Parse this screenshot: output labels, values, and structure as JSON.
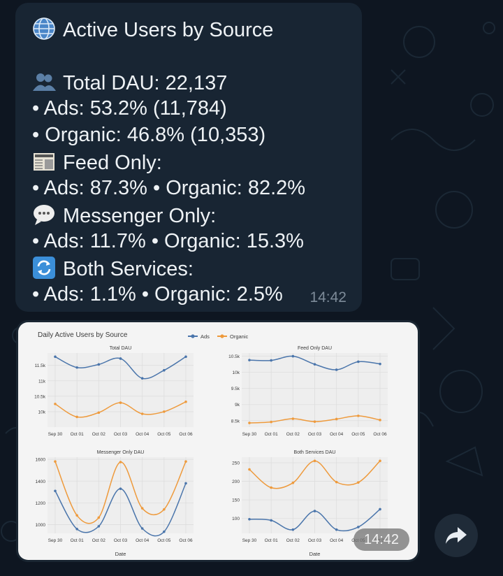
{
  "message": {
    "title_line": "Active Users by Source",
    "total_line": "Total DAU: 22,137",
    "ads_total": "• Ads: 53.2% (11,784)",
    "organic_total": "• Organic: 46.8% (10,353)",
    "feed_heading": "Feed Only:",
    "feed_line": "• Ads: 87.3% • Organic: 82.2%",
    "messenger_heading": "Messenger Only:",
    "messenger_line": "• Ads: 11.7% • Organic: 15.3%",
    "both_heading": "Both Services:",
    "both_line": "• Ads: 1.1% • Organic: 2.5%",
    "time": "14:42",
    "icons": [
      "globe-icon",
      "users-icon",
      "newspaper-icon",
      "speech-bubble-icon",
      "refresh-arrows-icon"
    ]
  },
  "photo": {
    "time": "14:42"
  },
  "share_icon": "share-arrow-icon",
  "colors": {
    "ads": "#4a75ab",
    "organic": "#ee9a3c",
    "bubble": "#182533",
    "background": "#0e1621"
  },
  "chart_data": {
    "title": "Daily Active Users by Source",
    "legend": [
      "Ads",
      "Organic"
    ],
    "legend_position": "top-center",
    "x": [
      "Sep 30",
      "Oct 01",
      "Oct 02",
      "Oct 03",
      "Oct 04",
      "Oct 05",
      "Oct 06"
    ],
    "xlabel": "Date",
    "panels": [
      {
        "title": "Total DAU",
        "type": "line",
        "ylim": [
          9500,
          11900
        ],
        "yticks": [
          10000,
          10500,
          11000,
          11500
        ],
        "ytick_labels": [
          "10k",
          "10.5k",
          "11k",
          "11.5k"
        ],
        "series": [
          {
            "name": "Ads",
            "values": [
              11780,
              11430,
              11530,
              11720,
              11080,
              11340,
              11780
            ]
          },
          {
            "name": "Organic",
            "values": [
              10250,
              9830,
              9970,
              10290,
              9930,
              10000,
              10320
            ]
          }
        ]
      },
      {
        "title": "Feed Only DAU",
        "type": "line",
        "ylim": [
          8300,
          10600
        ],
        "yticks": [
          8500,
          9000,
          9500,
          10000,
          10500
        ],
        "ytick_labels": [
          "8.5k",
          "9k",
          "9.5k",
          "10k",
          "10.5k"
        ],
        "series": [
          {
            "name": "Ads",
            "values": [
              10380,
              10370,
              10500,
              10250,
              10080,
              10330,
              10260
            ]
          },
          {
            "name": "Organic",
            "values": [
              8430,
              8460,
              8560,
              8470,
              8550,
              8650,
              8520
            ]
          }
        ]
      },
      {
        "title": "Messenger Only DAU",
        "type": "line",
        "ylim": [
          920,
          1620
        ],
        "yticks": [
          1000,
          1200,
          1400,
          1600
        ],
        "ytick_labels": [
          "1000",
          "1200",
          "1400",
          "1600"
        ],
        "series": [
          {
            "name": "Ads",
            "values": [
              1310,
              960,
              985,
              1330,
              965,
              935,
              1380
            ]
          },
          {
            "name": "Organic",
            "values": [
              1580,
              1085,
              1065,
              1575,
              1150,
              1140,
              1580
            ]
          }
        ]
      },
      {
        "title": "Both Services DAU",
        "type": "line",
        "ylim": [
          60,
          265
        ],
        "yticks": [
          100,
          150,
          200,
          250
        ],
        "ytick_labels": [
          "100",
          "150",
          "200",
          "250"
        ],
        "series": [
          {
            "name": "Ads",
            "values": [
              98,
              95,
              70,
              120,
              70,
              77,
              125
            ]
          },
          {
            "name": "Organic",
            "values": [
              232,
              183,
              196,
              255,
              198,
              197,
              255
            ]
          }
        ]
      }
    ]
  }
}
